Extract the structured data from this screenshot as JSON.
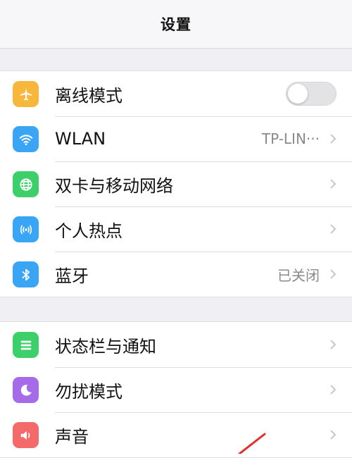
{
  "navbar": {
    "title": "设置"
  },
  "group1": [
    {
      "label": "离线模式",
      "icon": "airplane-icon",
      "color": "#f6b73c",
      "control": "toggle",
      "toggle_on": false
    },
    {
      "label": "WLAN",
      "icon": "wifi-icon",
      "color": "#3ba5f5",
      "value": "TP-LIN···",
      "control": "chevron"
    },
    {
      "label": "双卡与移动网络",
      "icon": "globe-icon",
      "color": "#3ccf6a",
      "control": "chevron"
    },
    {
      "label": "个人热点",
      "icon": "hotspot-icon",
      "color": "#3ba5f5",
      "control": "chevron"
    },
    {
      "label": "蓝牙",
      "icon": "bluetooth-icon",
      "color": "#3ba5f5",
      "value": "已关闭",
      "control": "chevron"
    }
  ],
  "group2": [
    {
      "label": "状态栏与通知",
      "icon": "notification-list-icon",
      "color": "#3ccf6a",
      "control": "chevron"
    },
    {
      "label": "勿扰模式",
      "icon": "moon-icon",
      "color": "#a56be8",
      "control": "chevron"
    },
    {
      "label": "声音",
      "icon": "speaker-icon",
      "color": "#f46a6a",
      "control": "chevron"
    }
  ],
  "colors": {
    "background": "#efeff4",
    "separator": "#dcdce0",
    "chevron": "#c7c7cc",
    "annotation": "#e0302a"
  }
}
